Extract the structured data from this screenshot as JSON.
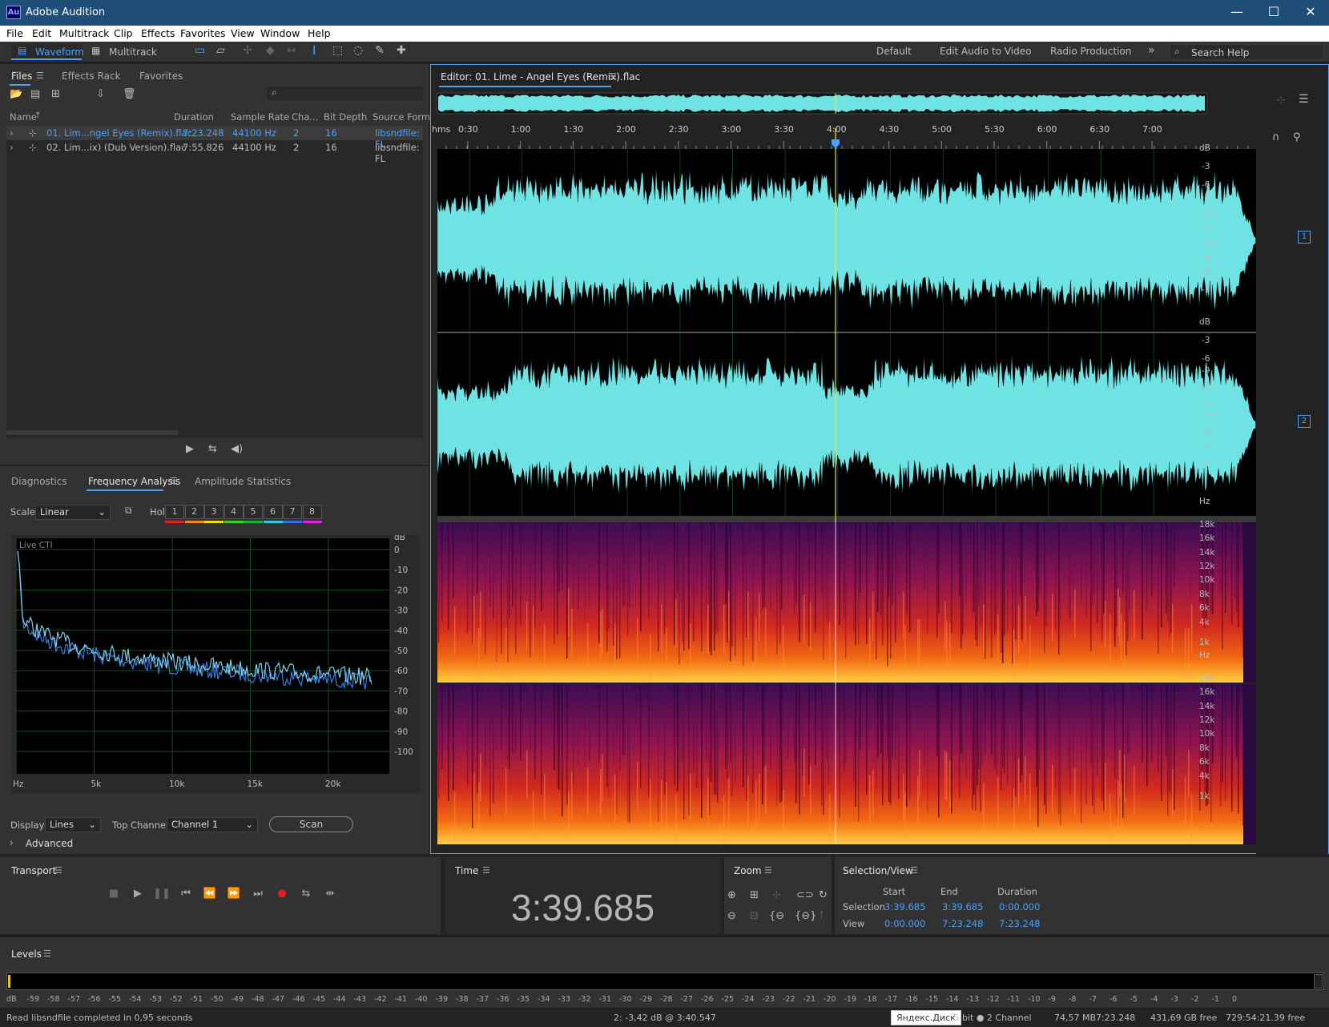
{
  "app": {
    "title": "Adobe Audition",
    "logo": "Au"
  },
  "window_controls": {
    "minimize": "—",
    "maximize": "☐",
    "close": "✕"
  },
  "menu": [
    "File",
    "Edit",
    "Multitrack",
    "Clip",
    "Effects",
    "Favorites",
    "View",
    "Window",
    "Help"
  ],
  "toolbar": {
    "waveform": "Waveform",
    "multitrack": "Multitrack",
    "workspaces": [
      "Default",
      "Edit Audio to Video",
      "Radio Production"
    ],
    "more": "»",
    "search_help": "Search Help"
  },
  "files_panel": {
    "tabs": [
      "Files",
      "Effects Rack",
      "Favorites"
    ],
    "columns": [
      "Name",
      "Duration",
      "Sample Rate",
      "Cha...",
      "Bit Depth",
      "Source Forma"
    ],
    "rows": [
      {
        "name": "01. Lim...ngel Eyes (Remix).flac",
        "duration": "7:23.248",
        "rate": "44100 Hz",
        "ch": "2",
        "bits": "16",
        "src": "libsndfile: FL"
      },
      {
        "name": "02. Lim...ix) (Dub Version).flac",
        "duration": "7:55.826",
        "rate": "44100 Hz",
        "ch": "2",
        "bits": "16",
        "src": "libsndfile: FL"
      }
    ]
  },
  "analysis_panel": {
    "tabs": [
      "Diagnostics",
      "Frequency Analysis",
      "Amplitude Statistics"
    ],
    "scale_label": "Scale:",
    "scale_value": "Linear",
    "hold_label": "Hold:",
    "hold_buttons": [
      "1",
      "2",
      "3",
      "4",
      "5",
      "6",
      "7",
      "8"
    ],
    "hold_colors": [
      "#e0201a",
      "#f08a10",
      "#f0e010",
      "#40d020",
      "#20b040",
      "#20d0e0",
      "#3070f0",
      "#e020e0"
    ],
    "live_cti": "Live CTI",
    "db_label": "dB",
    "db_ticks": [
      "0",
      "-10",
      "-20",
      "-30",
      "-40",
      "-50",
      "-60",
      "-70",
      "-80",
      "-90",
      "-100"
    ],
    "hz_ticks": [
      "Hz",
      "5k",
      "10k",
      "15k",
      "20k"
    ],
    "display_label": "Display:",
    "display_value": "Lines",
    "top_channel_label": "Top Channel:",
    "top_channel_value": "Channel 1",
    "scan": "Scan",
    "advanced": "Advanced"
  },
  "editor": {
    "title": "Editor: 01. Lime - Angel Eyes (Remix).flac",
    "ruler": [
      "hms",
      "0:30",
      "1:00",
      "1:30",
      "2:00",
      "2:30",
      "3:00",
      "3:30",
      "4:00",
      "4:30",
      "5:00",
      "5:30",
      "6:00",
      "6:30",
      "7:00"
    ],
    "db_scale": [
      "dB",
      "-3",
      "-6",
      "-9",
      "-15",
      "-∞",
      "-15",
      "-9",
      "-6",
      "-3"
    ],
    "channel_1": "1",
    "channel_2": "2",
    "hz_scale": [
      "Hz",
      "18k",
      "16k",
      "14k",
      "12k",
      "10k",
      "8k",
      "6k",
      "4k",
      "1k"
    ],
    "playhead_time": "3:39.685"
  },
  "transport": {
    "title": "Transport"
  },
  "time": {
    "title": "Time",
    "value": "3:39.685"
  },
  "zoom": {
    "title": "Zoom"
  },
  "selection_view": {
    "title": "Selection/View",
    "headers": [
      "Start",
      "End",
      "Duration"
    ],
    "selection_label": "Selection",
    "selection": [
      "3:39.685",
      "3:39.685",
      "0:00.000"
    ],
    "view_label": "View",
    "view": [
      "0:00.000",
      "7:23.248",
      "7:23.248"
    ]
  },
  "levels": {
    "title": "Levels",
    "scale": [
      "dB",
      "-59",
      "-58",
      "-57",
      "-56",
      "-55",
      "-54",
      "-53",
      "-52",
      "-51",
      "-50",
      "-49",
      "-48",
      "-47",
      "-46",
      "-45",
      "-44",
      "-43",
      "-42",
      "-41",
      "-40",
      "-39",
      "-38",
      "-37",
      "-36",
      "-35",
      "-34",
      "-33",
      "-32",
      "-31",
      "-30",
      "-29",
      "-28",
      "-27",
      "-26",
      "-25",
      "-24",
      "-23",
      "-22",
      "-21",
      "-20",
      "-19",
      "-18",
      "-17",
      "-16",
      "-15",
      "-14",
      "-13",
      "-12",
      "-11",
      "-10",
      "-9",
      "-8",
      "-7",
      "-6",
      "-5",
      "-4",
      "-3",
      "-2",
      "-1",
      "0"
    ]
  },
  "status": {
    "left": "Read libsndfile completed in 0,95 seconds",
    "cursor": "2: -3,42 dB @ 3:40.547",
    "yandex": "Яндекс.Диск",
    "format": "5-bit ● 2 Channel",
    "size": "74,57 MB",
    "duration": "7:23.248",
    "free": "431,69 GB free",
    "free_time": "729:54:21.39 free"
  },
  "colors": {
    "accent": "#4aa1ff",
    "waveform": "#6fe3e3",
    "titlebar": "#1f4e79",
    "playhead": "#e8e83a"
  }
}
